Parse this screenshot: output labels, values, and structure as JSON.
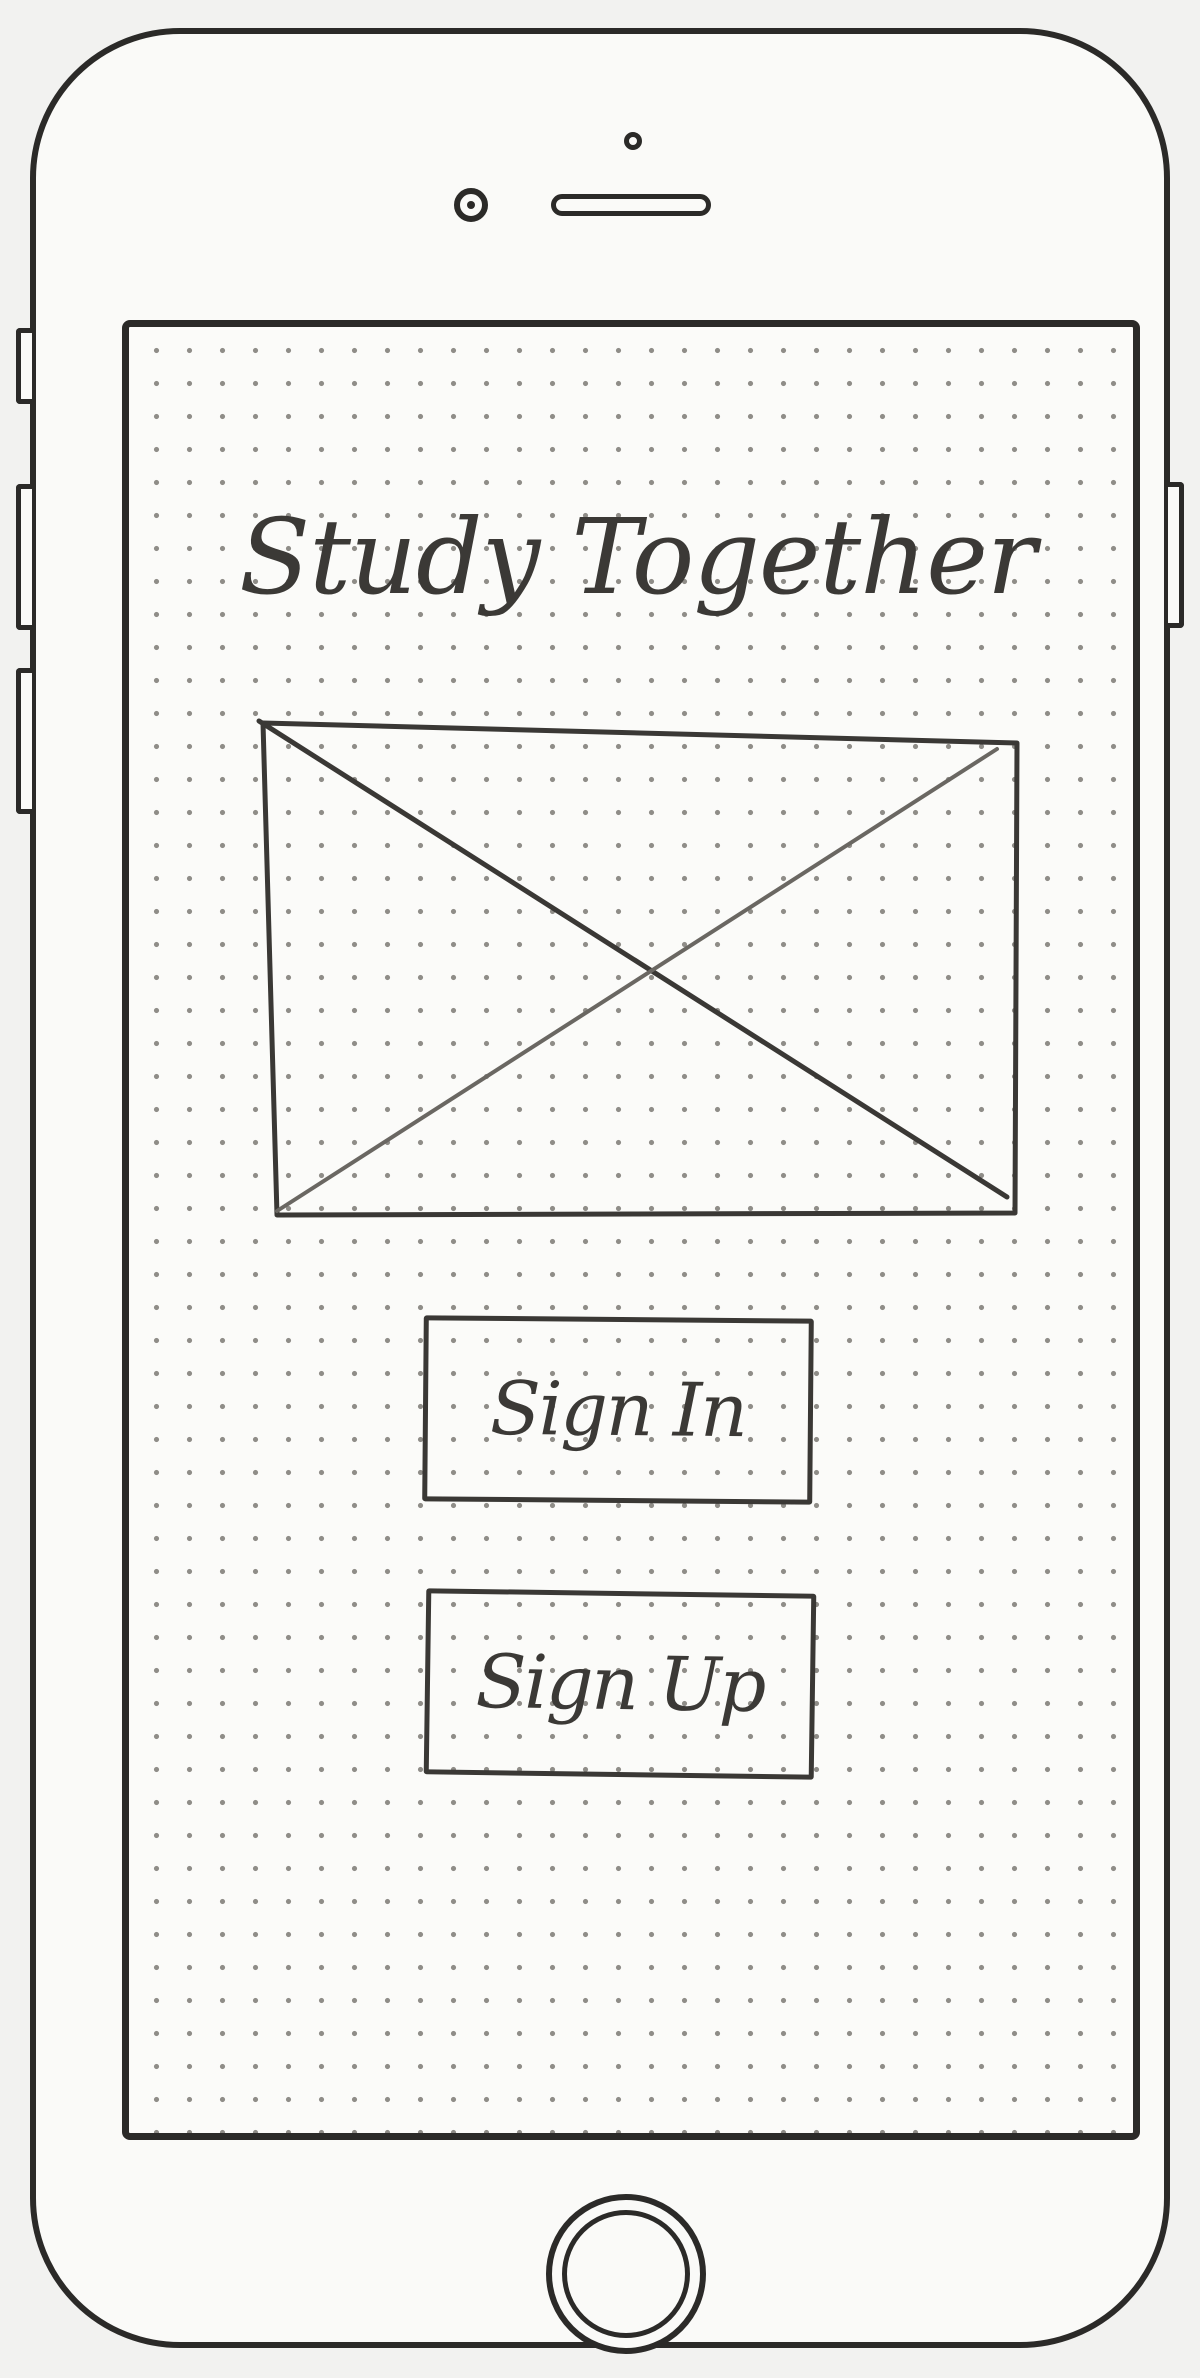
{
  "app": {
    "title": "Study Together"
  },
  "auth": {
    "sign_in_label": "Sign In",
    "sign_up_label": "Sign Up"
  },
  "colors": {
    "ink": "#2b2a28",
    "paper": "#fbfbf9",
    "dot_grid": "#8f8d88"
  },
  "icons": {
    "hero_placeholder": "image-placeholder-icon",
    "home": "home-button-icon"
  }
}
